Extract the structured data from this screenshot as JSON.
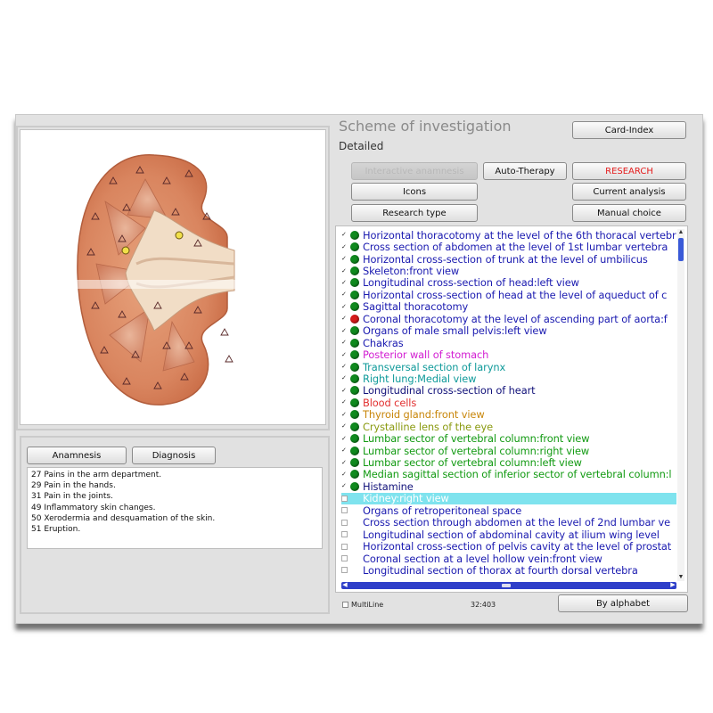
{
  "header": {
    "title": "Scheme of investigation",
    "subtitle": "Detailed"
  },
  "buttons": {
    "card_index": "Card-Index",
    "interactive_anamnesis": "Interactive anamnesis",
    "auto_therapy": "Auto-Therapy",
    "research": "RESEARCH",
    "icons": "Icons",
    "current_analysis": "Current analysis",
    "research_type": "Research type",
    "manual_choice": "Manual choice",
    "anamnesis": "Anamnesis",
    "diagnosis": "Diagnosis",
    "by_alphabet": "By alphabet"
  },
  "notes": [
    "27 Pains in the arm department.",
    "29 Pain in the hands.",
    "31 Pain in the joints.",
    "49 Inflammatory skin changes.",
    "50 Xerodermia and desquamation of the skin.",
    "51 Eruption."
  ],
  "list": [
    {
      "label": "Horizontal thoracotomy at the level of the 6th thoracal vertebr",
      "color": "#1a1ab0",
      "checked": true,
      "status": "green"
    },
    {
      "label": "Cross section of abdomen at the level of 1st lumbar vertebra",
      "color": "#1a1ab0",
      "checked": true,
      "status": "green"
    },
    {
      "label": "Horizontal cross-section of trunk at the level of umbilicus",
      "color": "#1a1ab0",
      "checked": true,
      "status": "green"
    },
    {
      "label": "Skeleton:front view",
      "color": "#1a1ab0",
      "checked": true,
      "status": "green"
    },
    {
      "label": "Longitudinal cross-section of head:left view",
      "color": "#1a1ab0",
      "checked": true,
      "status": "green"
    },
    {
      "label": "Horizontal cross-section of head at the level of aqueduct of c",
      "color": "#1a1ab0",
      "checked": true,
      "status": "green"
    },
    {
      "label": "Sagittal thoracotomy",
      "color": "#1a1ab0",
      "checked": true,
      "status": "green"
    },
    {
      "label": "Coronal thoracotomy at the level of ascending part of aorta:f",
      "color": "#1a1ab0",
      "checked": true,
      "status": "red"
    },
    {
      "label": "Organs of male small pelvis:left view",
      "color": "#1a1ab0",
      "checked": true,
      "status": "green"
    },
    {
      "label": "Chakras",
      "color": "#1a1ab0",
      "checked": true,
      "status": "green"
    },
    {
      "label": "Posterior wall of stomach",
      "color": "#d21ed2",
      "checked": true,
      "status": "green"
    },
    {
      "label": "Transversal section of larynx",
      "color": "#0f9a9a",
      "checked": true,
      "status": "green"
    },
    {
      "label": "Right lung:Medial view",
      "color": "#0f9a9a",
      "checked": true,
      "status": "green"
    },
    {
      "label": "Longitudinal cross-section of heart",
      "color": "#12127a",
      "checked": true,
      "status": "green"
    },
    {
      "label": "Blood cells",
      "color": "#e23030",
      "checked": true,
      "status": "green"
    },
    {
      "label": "Thyroid gland:front view",
      "color": "#c8860a",
      "checked": true,
      "status": "green"
    },
    {
      "label": "Crystalline lens of the eye",
      "color": "#8a9a10",
      "checked": true,
      "status": "green"
    },
    {
      "label": "Lumbar sector of vertebral column:front view",
      "color": "#129a12",
      "checked": true,
      "status": "green"
    },
    {
      "label": "Lumbar sector of vertebral column:right view",
      "color": "#129a12",
      "checked": true,
      "status": "green"
    },
    {
      "label": "Lumbar sector of vertebral column:left view",
      "color": "#129a12",
      "checked": true,
      "status": "green"
    },
    {
      "label": "Median sagittal section of inferior sector of vertebral column:l",
      "color": "#129a12",
      "checked": true,
      "status": "green"
    },
    {
      "label": "Histamine",
      "color": "#12127a",
      "checked": true,
      "status": "green"
    },
    {
      "label": "Kidney:right view",
      "color": "#ffffff",
      "checked": false,
      "status": "none",
      "selected": true
    },
    {
      "label": "Organs of retroperitoneal space",
      "color": "#1a1ab0",
      "checked": false,
      "status": "none"
    },
    {
      "label": "Cross section through abdomen at the level of 2nd lumbar ve",
      "color": "#1a1ab0",
      "checked": false,
      "status": "none"
    },
    {
      "label": "Longitudinal section of abdominal cavity at ilium wing level",
      "color": "#1a1ab0",
      "checked": false,
      "status": "none"
    },
    {
      "label": "Horizontal cross-section of pelvis cavity at the level of prostat",
      "color": "#1a1ab0",
      "checked": false,
      "status": "none"
    },
    {
      "label": "Coronal section at a level hollow vein:front view",
      "color": "#1a1ab0",
      "checked": false,
      "status": "none"
    },
    {
      "label": "Longitudinal section of thorax at fourth dorsal vertebra",
      "color": "#1a1ab0",
      "checked": false,
      "status": "none"
    }
  ],
  "status_colors": {
    "green": "#0f8a1e",
    "red": "#d61a1a"
  },
  "footer": {
    "multiline_label": "MultiLine",
    "counter": "32:403"
  }
}
